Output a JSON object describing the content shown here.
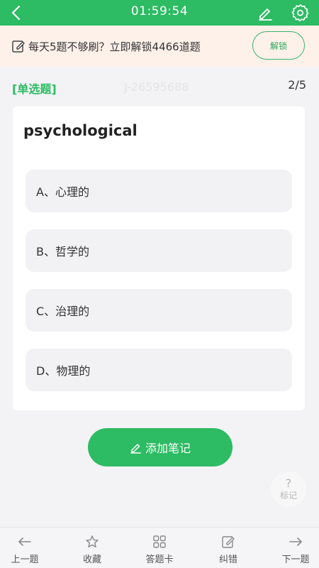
{
  "header": {
    "timer": "01:59:54"
  },
  "banner": {
    "text": "每天5题不够刷？立即解锁4466道题",
    "unlock_label": "解锁"
  },
  "question": {
    "type_label": "[单选题]",
    "id": "J-26595688",
    "progress": "2/5",
    "word": "psychological",
    "options": [
      {
        "label": "A、心理的"
      },
      {
        "label": "B、哲学的"
      },
      {
        "label": "C、治理的"
      },
      {
        "label": "D、物理的"
      }
    ]
  },
  "actions": {
    "add_note_label": "添加笔记",
    "mark_symbol": "?",
    "mark_label": "标记"
  },
  "tabbar": {
    "items": [
      {
        "label": "上一题",
        "icon": "arrow-left-icon"
      },
      {
        "label": "收藏",
        "icon": "star-icon"
      },
      {
        "label": "答题卡",
        "icon": "grid-icon"
      },
      {
        "label": "纠错",
        "icon": "edit-icon"
      },
      {
        "label": "下一题",
        "icon": "arrow-right-icon"
      }
    ]
  },
  "colors": {
    "accent": "#2dbb63",
    "banner_bg": "#fdf1ea",
    "page_bg": "#f3f3f5"
  }
}
